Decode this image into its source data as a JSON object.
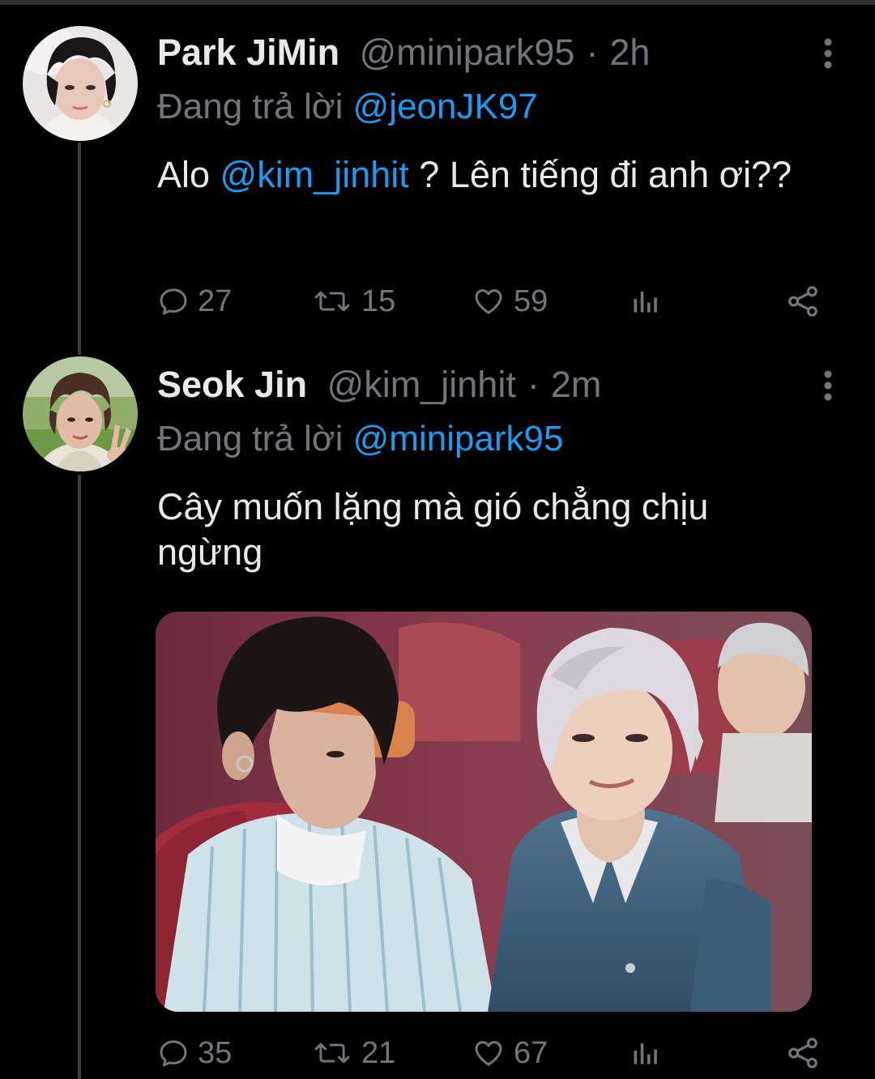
{
  "colors": {
    "background": "#000000",
    "text": "#e7e9ea",
    "muted": "#71767b",
    "link": "#1d9bf0",
    "thread_line": "#3a3d41"
  },
  "tweets": [
    {
      "display_name": "Park JiMin",
      "handle": "@minipark95",
      "dot": "·",
      "time": "2h",
      "reply_prefix": "Đang trả lời",
      "reply_to": "@jeonJK97",
      "text_parts": [
        "Alo ",
        "@kim_jinhit",
        " ? Lên tiếng đi anh ơi??"
      ],
      "stats": {
        "replies": "27",
        "retweets": "15",
        "likes": "59"
      },
      "icons": [
        "reply-icon",
        "retweet-icon",
        "like-icon",
        "analytics-icon",
        "share-icon",
        "more-icon"
      ]
    },
    {
      "display_name": "Seok Jin",
      "handle": "@kim_jinhit",
      "dot": "·",
      "time": "2m",
      "reply_prefix": "Đang trả lời",
      "reply_to": "@minipark95",
      "text": "Cây muốn lặng mà gió chẳng chịu ngừng",
      "stats": {
        "replies": "35",
        "retweets": "21",
        "likes": "67"
      },
      "icons": [
        "reply-icon",
        "retweet-icon",
        "like-icon",
        "analytics-icon",
        "share-icon",
        "more-icon"
      ]
    }
  ]
}
